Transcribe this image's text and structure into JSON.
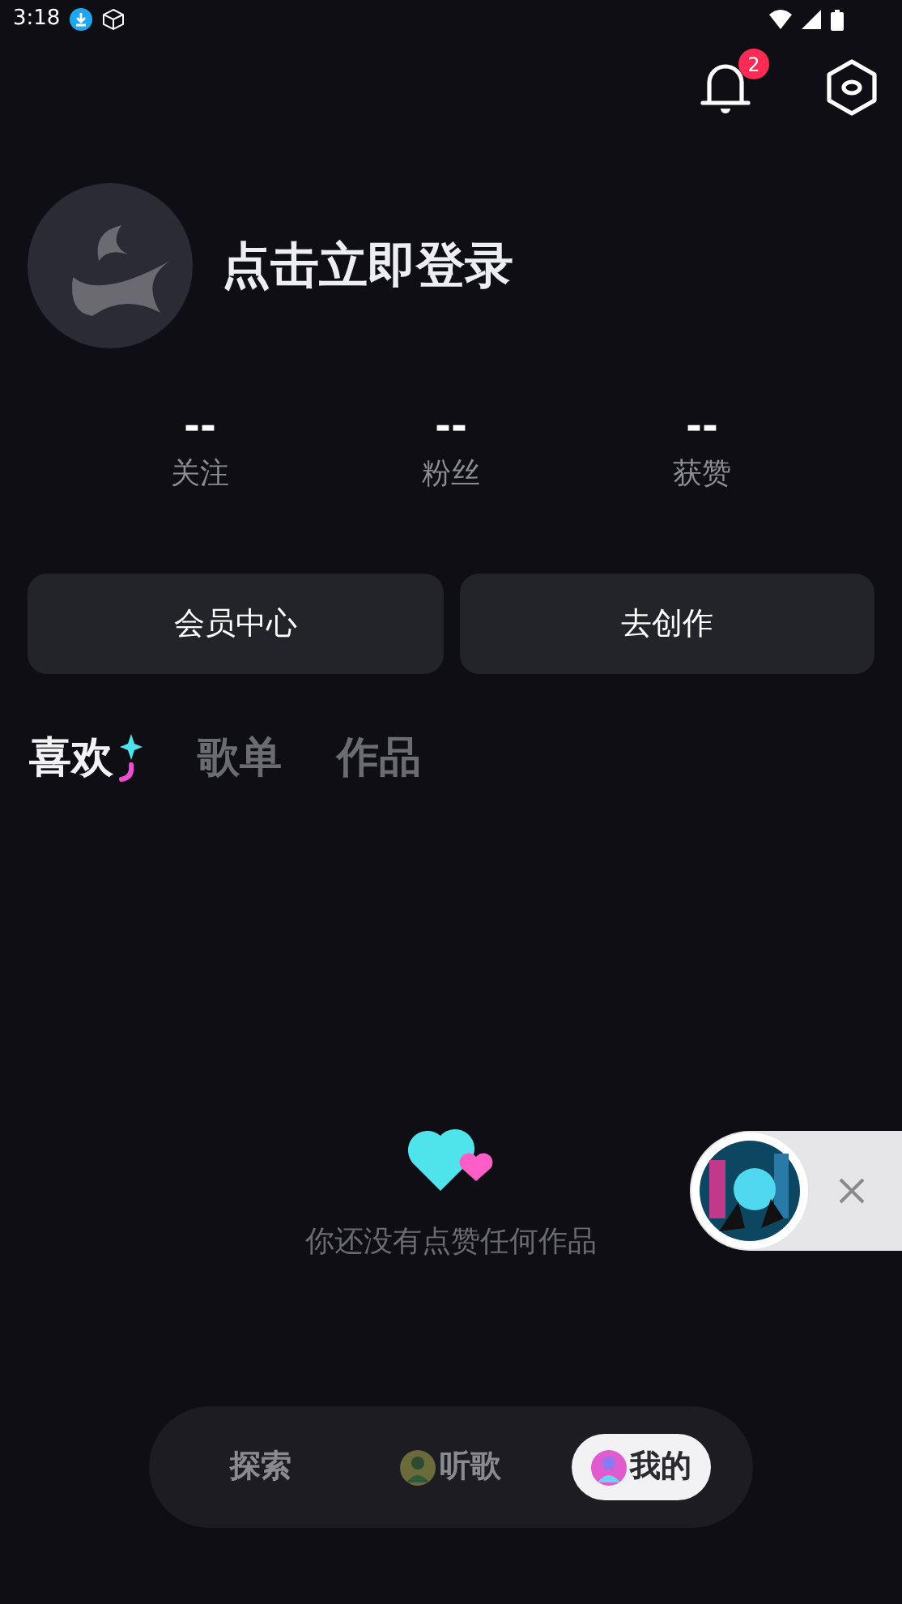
{
  "status_bar": {
    "time": "3:18"
  },
  "header": {
    "notification_count": "2"
  },
  "profile": {
    "name": "点击立即登录"
  },
  "stats": [
    {
      "value": "--",
      "label": "关注"
    },
    {
      "value": "--",
      "label": "粉丝"
    },
    {
      "value": "--",
      "label": "获赞"
    }
  ],
  "actions": [
    "会员中心",
    "去创作"
  ],
  "tabs": [
    {
      "label": "喜欢",
      "selected": true
    },
    {
      "label": "歌单",
      "selected": false
    },
    {
      "label": "作品",
      "selected": false
    }
  ],
  "empty_state": {
    "text": "你还没有点赞任何作品"
  },
  "bottom_nav": [
    {
      "label": "探索",
      "selected": false,
      "kind": "text"
    },
    {
      "label": "听歌",
      "selected": false,
      "kind": "avatar"
    },
    {
      "label": "我的",
      "selected": true,
      "kind": "avatar"
    }
  ]
}
